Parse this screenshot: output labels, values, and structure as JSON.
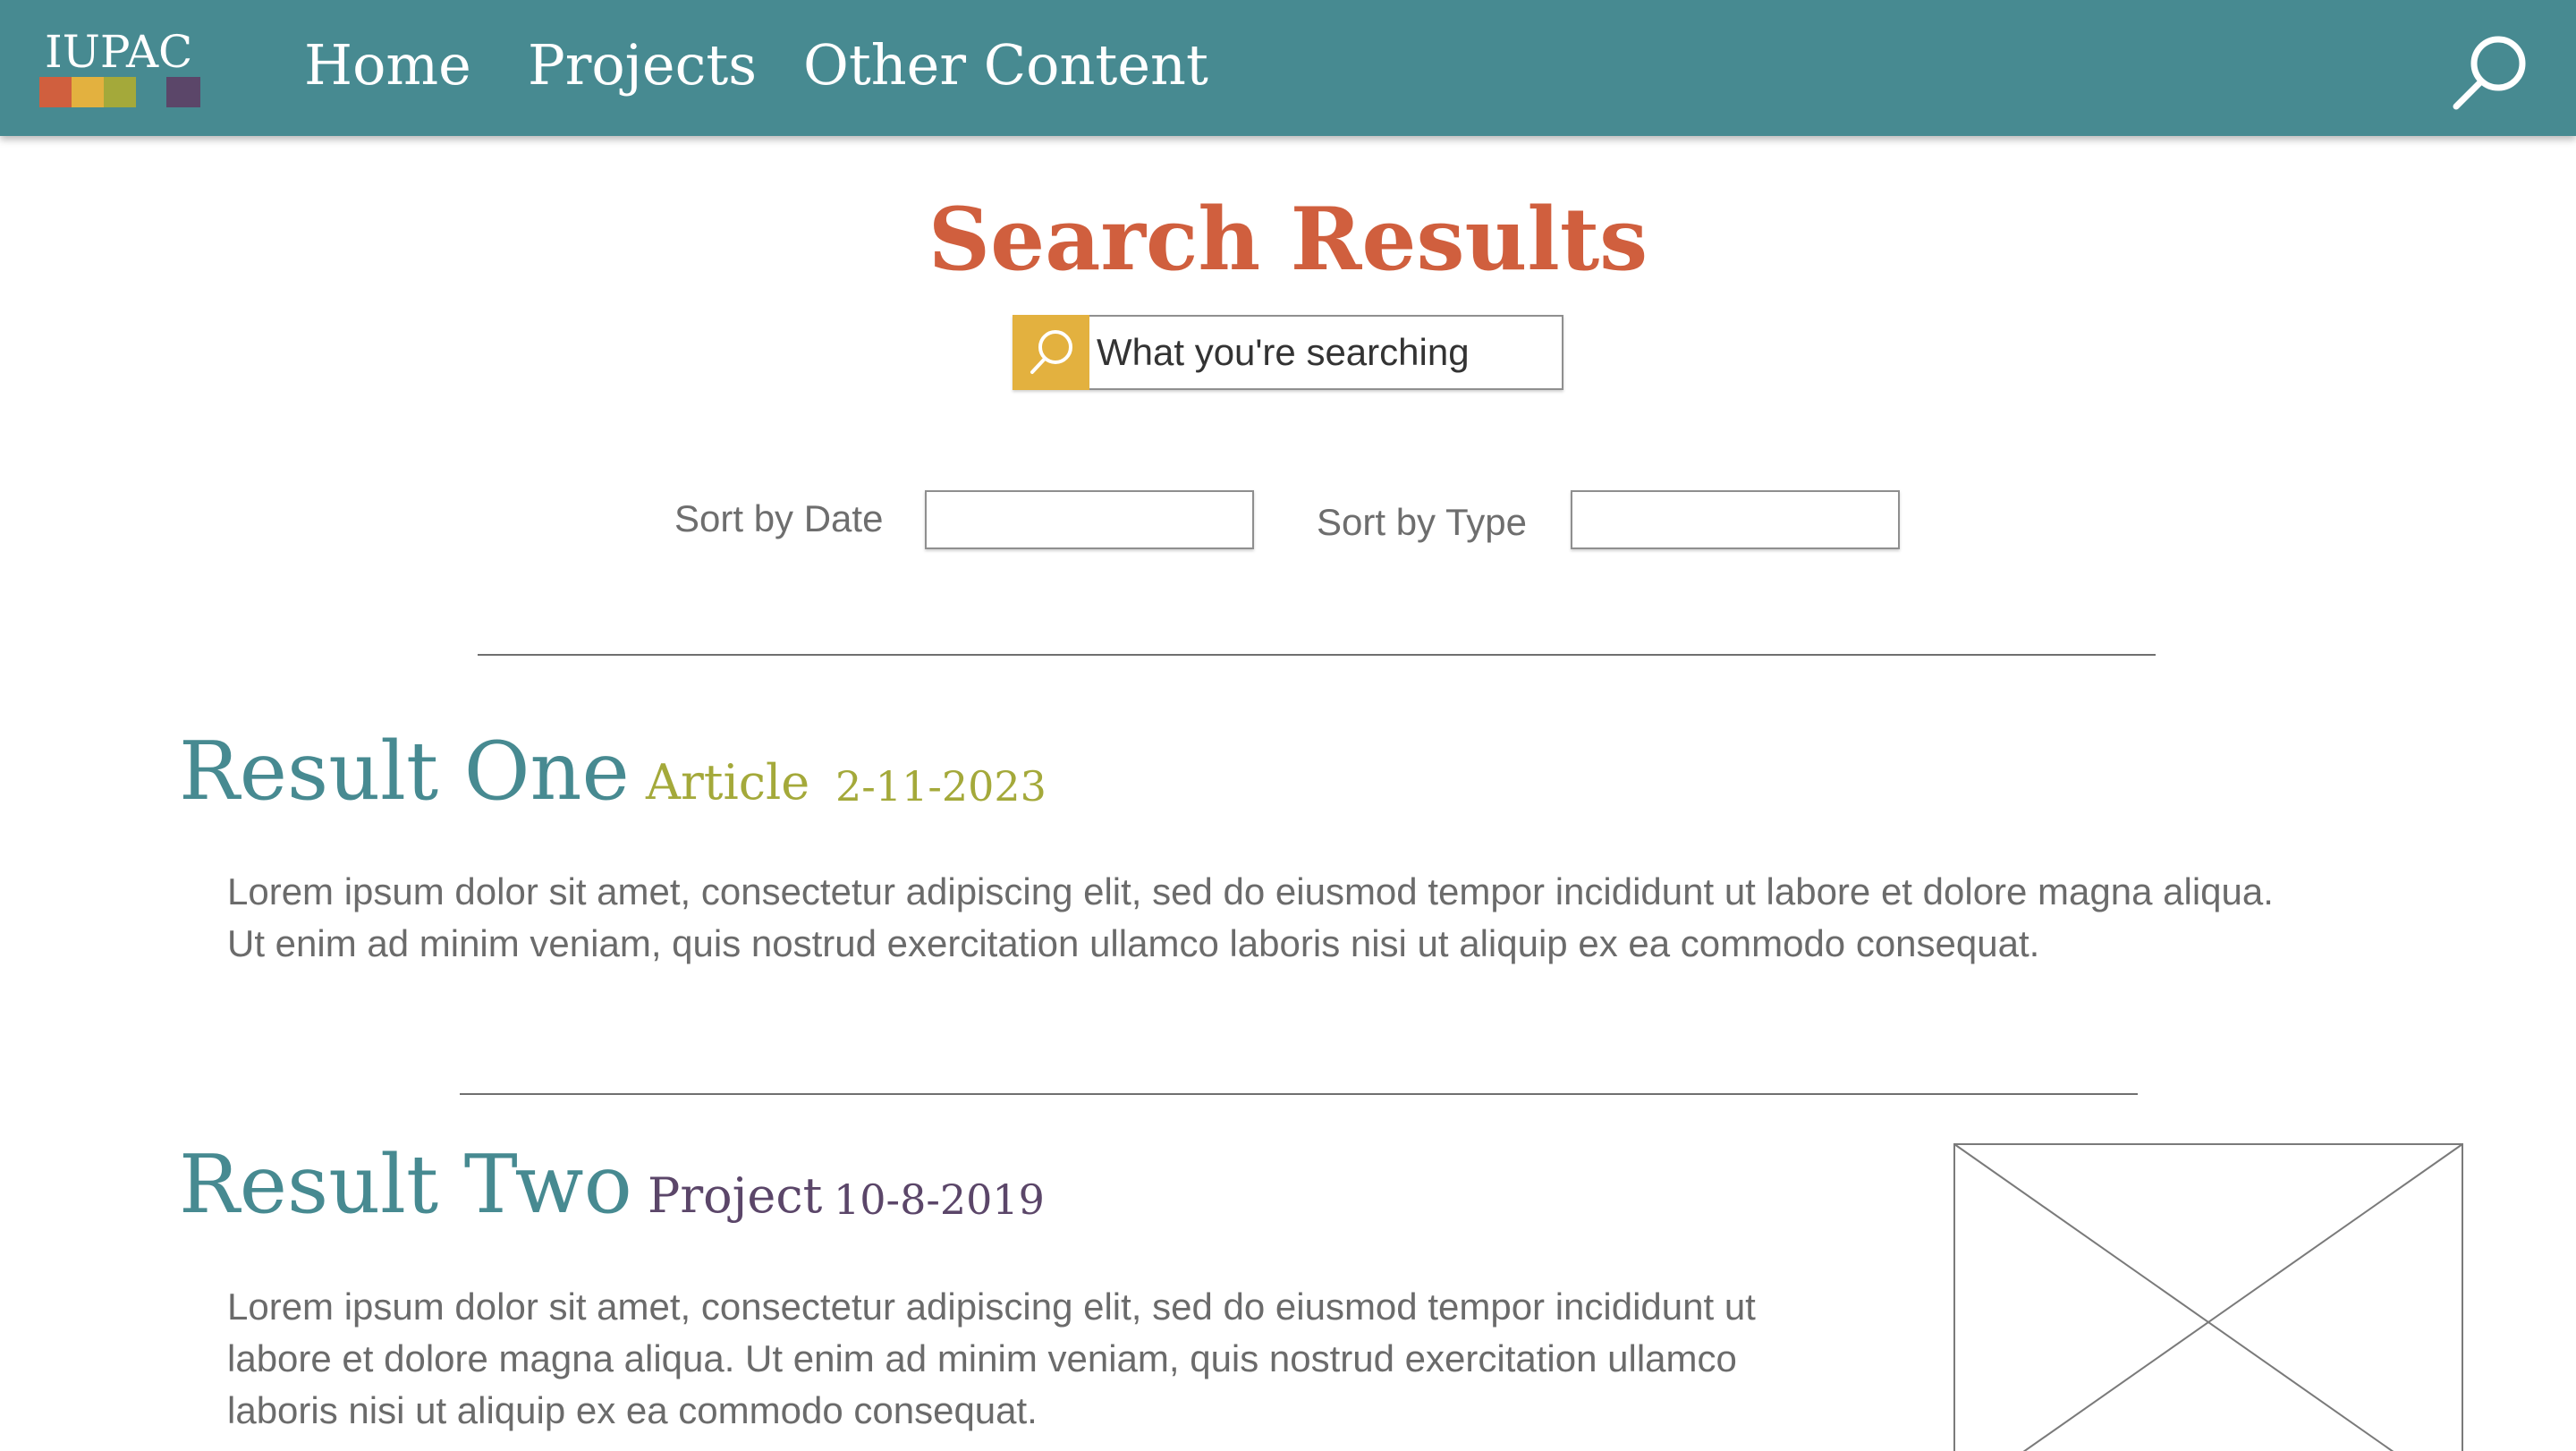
{
  "header": {
    "logo_text": "IUPAC",
    "logo_colors": [
      "#d05f3e",
      "#e3b13f",
      "#a4a93a",
      "#5b4669"
    ],
    "nav": [
      {
        "label": "Home"
      },
      {
        "label": "Projects"
      },
      {
        "label": "Other Content"
      }
    ],
    "search_icon": "search-icon",
    "background": "#478a91"
  },
  "page": {
    "title": "Search Results",
    "title_color": "#d05f3e"
  },
  "search": {
    "placeholder": "What you're searching",
    "value": "",
    "button_icon": "search-icon",
    "button_color": "#e3b13f"
  },
  "sort": {
    "date_label": "Sort by Date",
    "date_value": "",
    "type_label": "Sort by Type",
    "type_value": ""
  },
  "results": [
    {
      "title": "Result One",
      "type": "Article",
      "type_color": "#a4a93a",
      "date": "2-11-2023",
      "text_lines": [
        "Lorem ipsum dolor sit amet, consectetur adipiscing elit, sed do eiusmod tempor incididunt ut labore et dolore magna aliqua.",
        "Ut enim ad minim veniam, quis nostrud exercitation ullamco laboris nisi ut aliquip ex ea commodo consequat."
      ]
    },
    {
      "title": "Result Two",
      "type": "Project",
      "type_color": "#5b4669",
      "date": "10-8-2019",
      "text_lines": [
        "Lorem ipsum dolor sit amet, consectetur adipiscing elit, sed do eiusmod tempor incididunt ut",
        "labore et dolore magna aliqua. Ut enim ad minim veniam, quis nostrud exercitation ullamco",
        "laboris nisi ut aliquip ex ea commodo consequat."
      ],
      "thumbnail": "image-placeholder"
    }
  ]
}
